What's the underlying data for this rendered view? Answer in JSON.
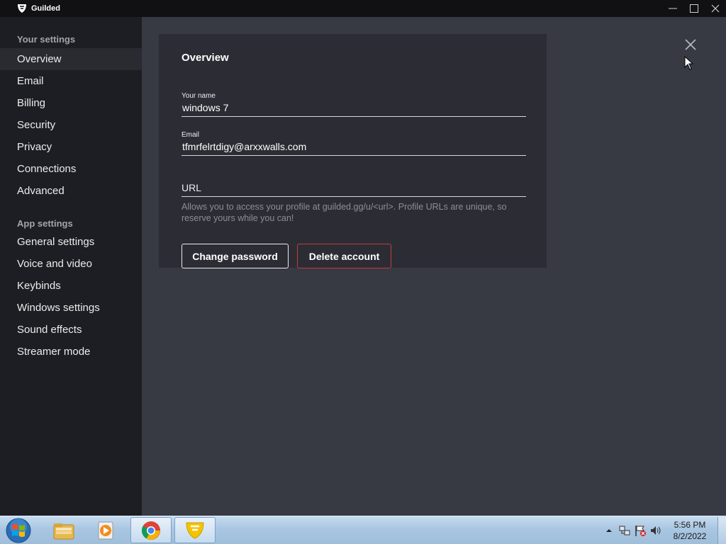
{
  "window": {
    "title": "Guilded"
  },
  "sidebar": {
    "your_settings_heading": "Your settings",
    "your_settings_items": [
      "Overview",
      "Email",
      "Billing",
      "Security",
      "Privacy",
      "Connections",
      "Advanced"
    ],
    "app_settings_heading": "App settings",
    "app_settings_items": [
      "General settings",
      "Voice and video",
      "Keybinds",
      "Windows settings",
      "Sound effects",
      "Streamer mode"
    ],
    "active_item": "Overview"
  },
  "overview": {
    "title": "Overview",
    "name_label": "Your name",
    "name_value": "windows 7",
    "email_label": "Email",
    "email_value": "tfmrfelrtdigy@arxxwalls.com",
    "url_placeholder": "URL",
    "url_value": "",
    "url_hint": "Allows you to access your profile at guilded.gg/u/<url>. Profile URLs are unique, so reserve yours while you can!",
    "change_password_label": "Change password",
    "delete_account_label": "Delete account"
  },
  "taskbar": {
    "items": [
      "start-orb",
      "windows-explorer",
      "media-player",
      "google-chrome",
      "guilded"
    ],
    "clock_time": "5:56 PM",
    "clock_date": "8/2/2022"
  },
  "colors": {
    "sidebar_bg": "#1d1e23",
    "main_bg": "#373943",
    "card_bg": "#2c2d34",
    "accent": "#f5c400",
    "danger": "#c23b3b"
  }
}
